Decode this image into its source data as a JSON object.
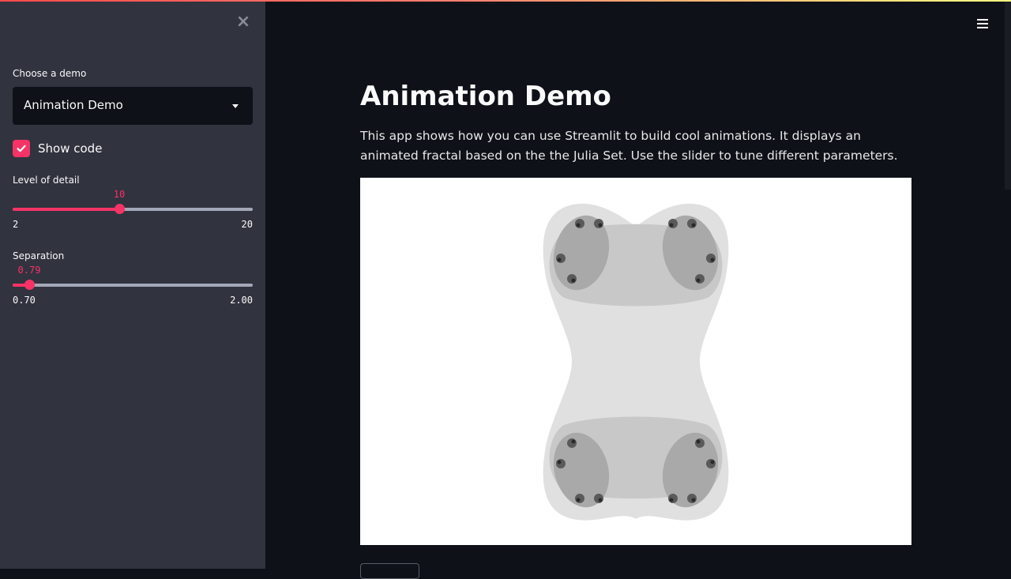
{
  "sidebar": {
    "demo_select": {
      "label": "Choose a demo",
      "value": "Animation Demo"
    },
    "show_code": {
      "label": "Show code",
      "checked": true
    },
    "level_of_detail": {
      "label": "Level of detail",
      "value": "10",
      "min": "2",
      "max": "20",
      "fraction": 0.444
    },
    "separation": {
      "label": "Separation",
      "value": "0.79",
      "min": "0.70",
      "max": "2.00",
      "fraction": 0.069
    }
  },
  "main": {
    "title": "Animation Demo",
    "description": "This app shows how you can use Streamlit to build cool animations. It displays an animated fractal based on the the Julia Set. Use the slider to tune different parameters."
  },
  "icons": {
    "close": "close-icon",
    "menu": "hamburger-menu-icon",
    "caret": "chevron-down-icon",
    "check": "check-icon"
  },
  "colors": {
    "accent": "#f63366",
    "sidebar_bg": "#31333f",
    "main_bg": "#0e1117"
  }
}
